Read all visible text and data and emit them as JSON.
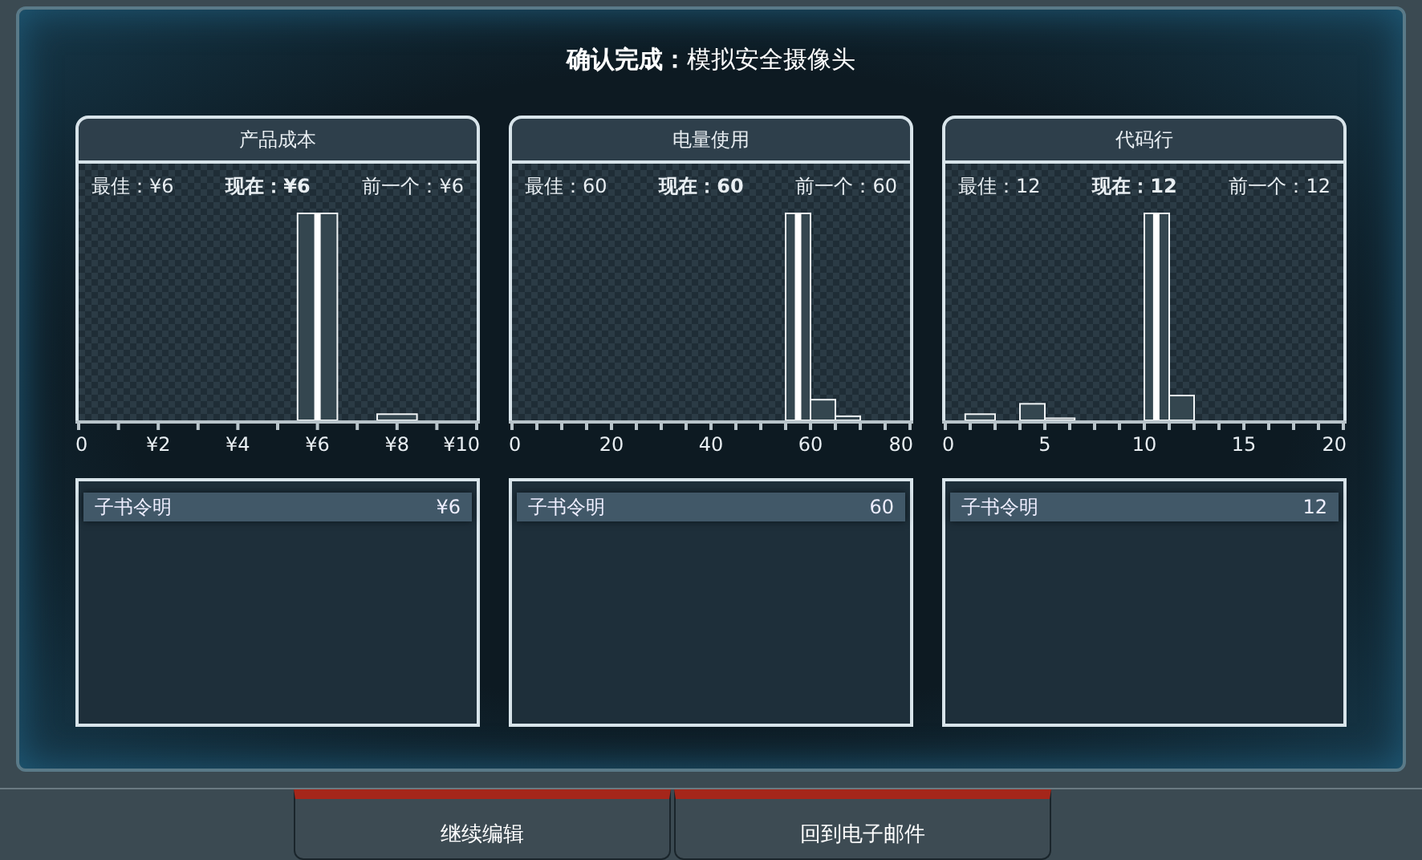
{
  "title": "**确认完成：**模拟安全摄像头",
  "panels": [
    {
      "title": "产品成本",
      "best": "最佳：¥6",
      "current": "现在：¥6",
      "previous": "前一个：¥6",
      "ticks": [
        "0",
        "¥2",
        "¥4",
        "¥6",
        "¥8",
        "¥10"
      ],
      "entries": [
        {
          "name": "子书令明",
          "value": "¥6"
        }
      ]
    },
    {
      "title": "电量使用",
      "best": "最佳：60",
      "current": "现在：60",
      "previous": "前一个：60",
      "ticks": [
        "0",
        "20",
        "40",
        "60",
        "80"
      ],
      "entries": [
        {
          "name": "子书令明",
          "value": "60"
        }
      ]
    },
    {
      "title": "代码行",
      "best": "最佳：12",
      "current": "现在：12",
      "previous": "前一个：12",
      "ticks": [
        "0",
        "5",
        "10",
        "15",
        "20"
      ],
      "entries": [
        {
          "name": "子书令明",
          "value": "12"
        }
      ]
    }
  ],
  "buttons": [
    "继续编辑",
    "回到电子邮件"
  ]
}
